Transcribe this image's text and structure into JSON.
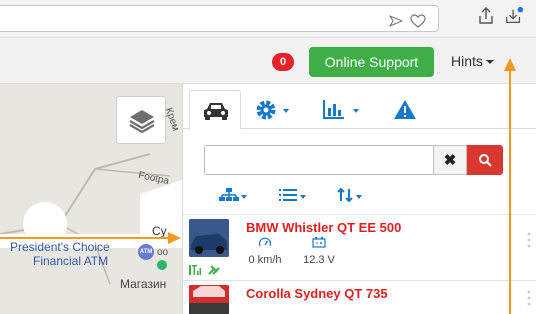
{
  "header": {
    "notification_count": "0",
    "support_label": "Online Support",
    "hints_label": "Hints"
  },
  "map": {
    "road_label": "Footpa",
    "road_label_2": "Крем",
    "poi_prefix": "Cy",
    "poi_line1": "President's Choice",
    "poi_line2": "Financial ATM",
    "atm_badge": "ATM",
    "cut_label": "oo",
    "store_label": "Магазин"
  },
  "search": {
    "placeholder": ""
  },
  "vehicles": [
    {
      "name": "BMW Whistler QT EE 500",
      "speed": "0 km/h",
      "voltage": "12.3 V"
    },
    {
      "name": "Corolla Sydney QT 735"
    }
  ],
  "colors": {
    "accent_blue": "#1778c8",
    "support_green": "#3fae49",
    "alert_red": "#e8202a",
    "annotation_orange": "#f39a1e"
  }
}
